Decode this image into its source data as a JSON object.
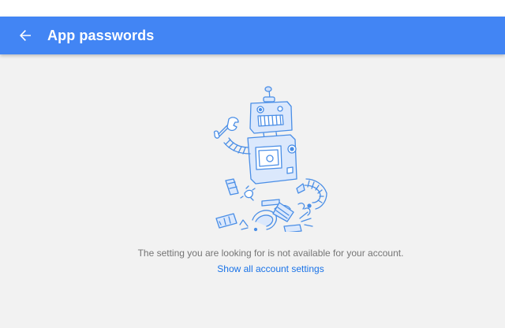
{
  "header": {
    "title": "App passwords",
    "back_icon": "arrow-back-icon",
    "color": "#4285f4"
  },
  "main": {
    "illustration": "broken-robot-illustration",
    "message": "The setting you are looking for is not available for your account.",
    "link_label": "Show all account settings",
    "link_color": "#1a73e8"
  }
}
